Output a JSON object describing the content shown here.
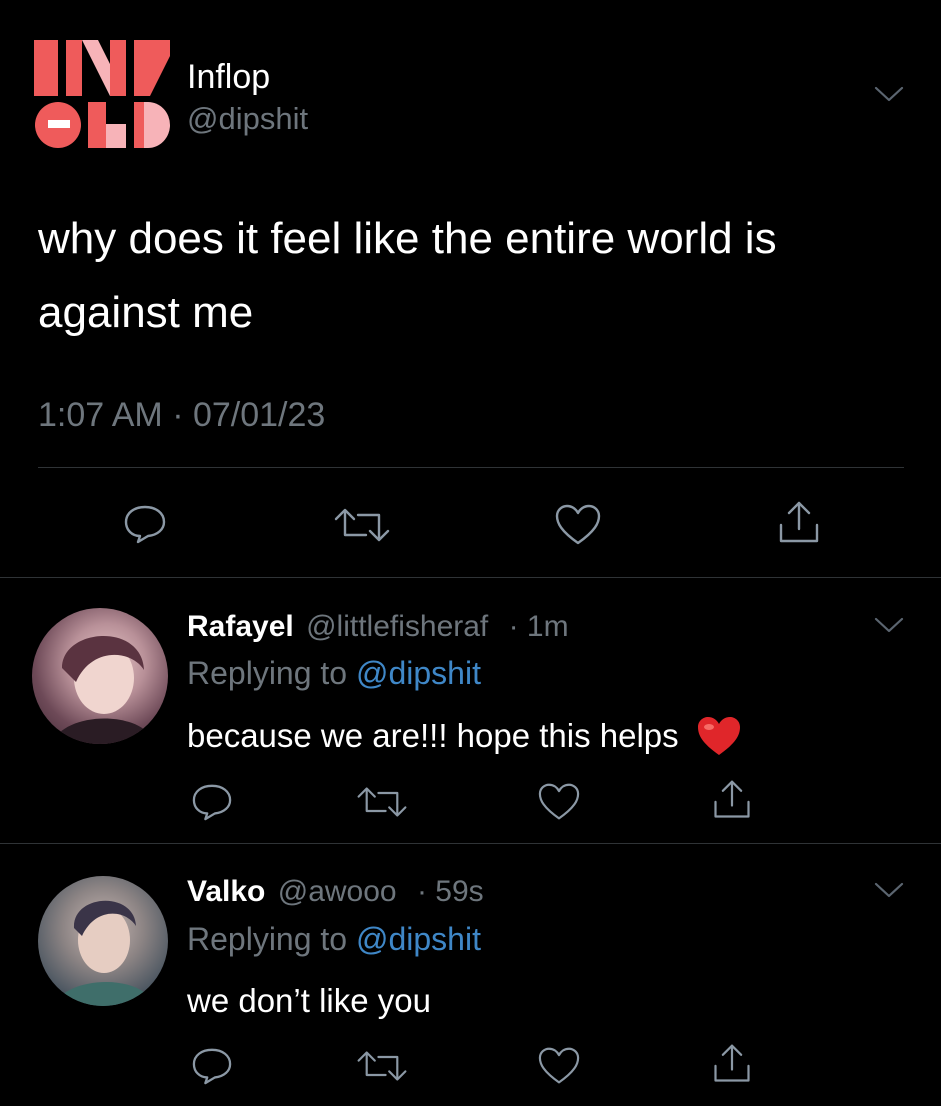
{
  "main_tweet": {
    "display_name": "Inflop",
    "handle": "@dipshit",
    "avatar_logo_text": "INFLOP",
    "text": "why does it feel like the entire world is against me",
    "timestamp": "1:07 AM · 07/01/23",
    "avatar_colors": {
      "coral": "#ef5b5b",
      "pink": "#f7b3b8",
      "white": "#ffffff"
    }
  },
  "replies": [
    {
      "display_name": "Rafayel",
      "handle": "@littlefisheraf",
      "time": "· 1m",
      "replying_prefix": "Replying to",
      "replying_handle": "@dipshit",
      "text": "because we are!!! hope this helps",
      "emoji": "red-heart"
    },
    {
      "display_name": "Valko",
      "handle": "@awooo",
      "time": "· 59s",
      "replying_prefix": "Replying to",
      "replying_handle": "@dipshit",
      "text": "we don’t like you"
    }
  ],
  "actions": [
    "reply-icon",
    "retweet-icon",
    "like-icon",
    "share-icon"
  ],
  "theme": {
    "background": "#000000",
    "text": "#ffffff",
    "muted": "#6e767d",
    "link": "#3f87c7",
    "divider": "#2f3336"
  }
}
